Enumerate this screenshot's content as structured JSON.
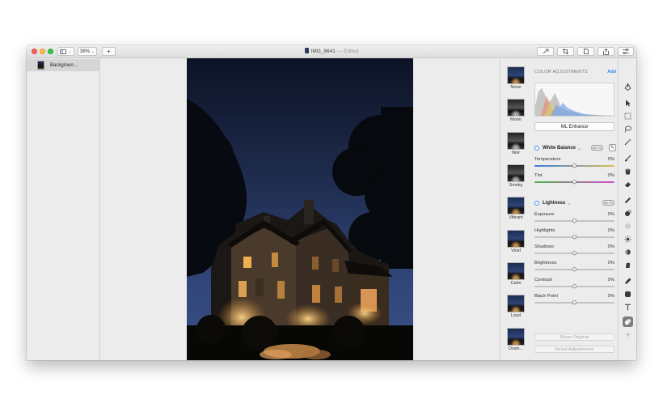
{
  "window": {
    "title": "IMG_8641",
    "title_suffix": "— Edited",
    "zoom": "39%"
  },
  "toolbar": {
    "sidebar_toggle_icon": "sidebar-icon",
    "add_label": "+",
    "right_buttons": [
      "brush-icon",
      "crop-icon",
      "shapes-icon",
      "share-icon",
      "sliders-icon"
    ]
  },
  "sidebar": {
    "layers": [
      {
        "label": "Backgroun..."
      }
    ]
  },
  "presets": [
    {
      "label": "None"
    },
    {
      "label": "Mono"
    },
    {
      "label": "Noir"
    },
    {
      "label": "Smoky"
    },
    {
      "label": "Vibrant"
    },
    {
      "label": "Vivid"
    },
    {
      "label": "Calm"
    },
    {
      "label": "Loud"
    },
    {
      "label": "Dram..."
    }
  ],
  "adjustments": {
    "section_title": "COLOR ADJUSTMENTS",
    "add_label": "Add",
    "ml_enhance_label": "ML Enhance",
    "white_balance": {
      "title": "White Balance",
      "chevron": "⌄",
      "pill": "ML Fx",
      "temperature": {
        "label": "Temperature",
        "value": "0%"
      },
      "tint": {
        "label": "Tint",
        "value": "0%"
      }
    },
    "lightness": {
      "title": "Lightness",
      "chevron": "⌄",
      "pill": "ML Fx",
      "sliders": [
        {
          "label": "Exposure",
          "value": "0%"
        },
        {
          "label": "Highlights",
          "value": "0%"
        },
        {
          "label": "Shadows",
          "value": "0%"
        },
        {
          "label": "Brightness",
          "value": "0%"
        },
        {
          "label": "Contrast",
          "value": "0%"
        },
        {
          "label": "Black Point",
          "value": "0%"
        }
      ]
    },
    "show_original_label": "Show Original",
    "reset_label": "Reset Adjustments"
  },
  "colors": {
    "accent": "#2f7cf6",
    "close": "#fc605b",
    "minimize": "#fdbc40",
    "maximize": "#34c84a"
  },
  "tools": [
    "pen-nib-icon",
    "arrow-pointer-icon",
    "rect-select-icon",
    "lasso-icon",
    "magic-wand-icon",
    "brush-icon",
    "bucket-icon",
    "eraser-icon",
    "pencil-icon",
    "clone-icon",
    "blur-icon",
    "sun-icon",
    "burn-icon",
    "smudge-icon",
    "pen-icon",
    "shape-icon",
    "text-icon",
    "color-adjust-icon",
    "sparkle-icon"
  ]
}
